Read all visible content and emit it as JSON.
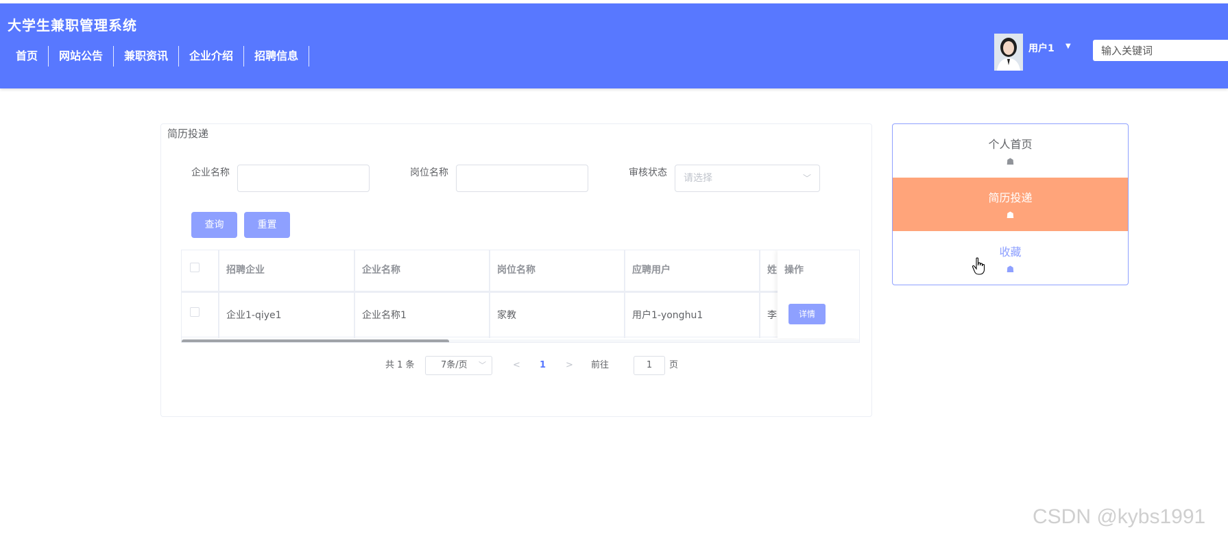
{
  "header": {
    "site_title": "大学生兼职管理系统",
    "nav": [
      "首页",
      "网站公告",
      "兼职资讯",
      "企业介绍",
      "招聘信息"
    ],
    "user_name": "用户1",
    "search_placeholder": "输入关键词"
  },
  "panel": {
    "title": "简历投递",
    "filters": {
      "company_label": "企业名称",
      "position_label": "岗位名称",
      "status_label": "审核状态",
      "status_placeholder": "请选择"
    },
    "buttons": {
      "query": "查询",
      "reset": "重置"
    },
    "table": {
      "columns": [
        "招聘企业",
        "企业名称",
        "岗位名称",
        "应聘用户",
        "姓",
        "操作"
      ],
      "rows": [
        {
          "recruiter": "企业1-qiye1",
          "company": "企业名称1",
          "position": "家教",
          "applicant": "用户1-yonghu1",
          "name": "李",
          "action": "详情"
        }
      ]
    },
    "pagination": {
      "total": "共 1 条",
      "page_size": "7条/页",
      "current_page": "1",
      "goto_label": "前往",
      "goto_value": "1",
      "page_suffix": "页"
    }
  },
  "side_menu": {
    "items": [
      {
        "label": "个人首页",
        "icon": "home-icon",
        "state": "normal"
      },
      {
        "label": "简历投递",
        "icon": "home-icon",
        "state": "active"
      },
      {
        "label": "收藏",
        "icon": "home-icon",
        "state": "hover"
      }
    ],
    "colors": {
      "active_bg": "#ffa47a",
      "hover_text": "#8ea0ff"
    }
  },
  "watermark": "CSDN @kybs1991",
  "colors": {
    "header": "#5878ff",
    "button": "#8ea0ff"
  }
}
